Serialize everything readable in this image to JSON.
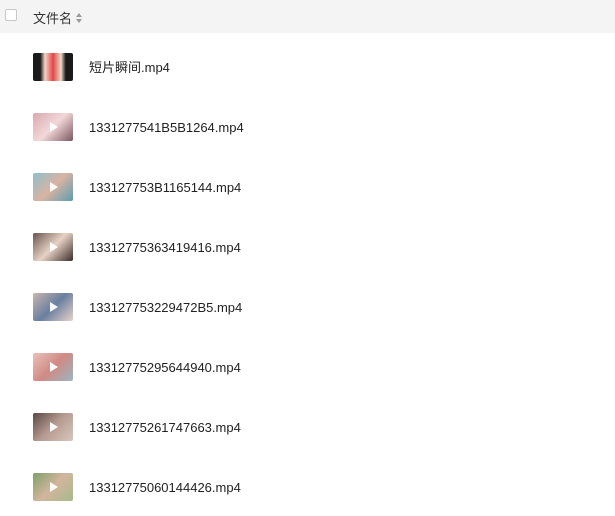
{
  "header": {
    "column_name_label": "文件名",
    "sort_icon": "sort-updown-icon"
  },
  "files": [
    {
      "name": "短片瞬间.mp4",
      "thumb_icon": "video-thumbnail",
      "thumb_colors": [
        "#1a1a1a",
        "#e04646",
        "#f2d6c9"
      ],
      "play": false
    },
    {
      "name": "1331277541B5B1264.mp4",
      "thumb_icon": "video-thumbnail",
      "thumb_colors": [
        "#d7a9b2",
        "#f3d8d8",
        "#7a5660"
      ],
      "play": true
    },
    {
      "name": "133127753B1165144.mp4",
      "thumb_icon": "video-thumbnail",
      "thumb_colors": [
        "#8fbfcc",
        "#d9b3a2",
        "#5d9db0"
      ],
      "play": true
    },
    {
      "name": "13312775363419416.mp4",
      "thumb_icon": "video-thumbnail",
      "thumb_colors": [
        "#6a5550",
        "#e7d2c5",
        "#3b2c29"
      ],
      "play": true
    },
    {
      "name": "133127753229472B5.mp4",
      "thumb_icon": "video-thumbnail",
      "thumb_colors": [
        "#c9b6ae",
        "#6a7fa0",
        "#e8d3cb"
      ],
      "play": true
    },
    {
      "name": "13312775295644940.mp4",
      "thumb_icon": "video-thumbnail",
      "thumb_colors": [
        "#e8c2bb",
        "#d08a84",
        "#9db5c0"
      ],
      "play": true
    },
    {
      "name": "13312775261747663.mp4",
      "thumb_icon": "video-thumbnail",
      "thumb_colors": [
        "#5a4845",
        "#b79c92",
        "#d9c6bd"
      ],
      "play": true
    },
    {
      "name": "13312775060144426.mp4",
      "thumb_icon": "video-thumbnail",
      "thumb_colors": [
        "#7ea06b",
        "#d2b59d",
        "#a7b98b"
      ],
      "play": true
    }
  ]
}
